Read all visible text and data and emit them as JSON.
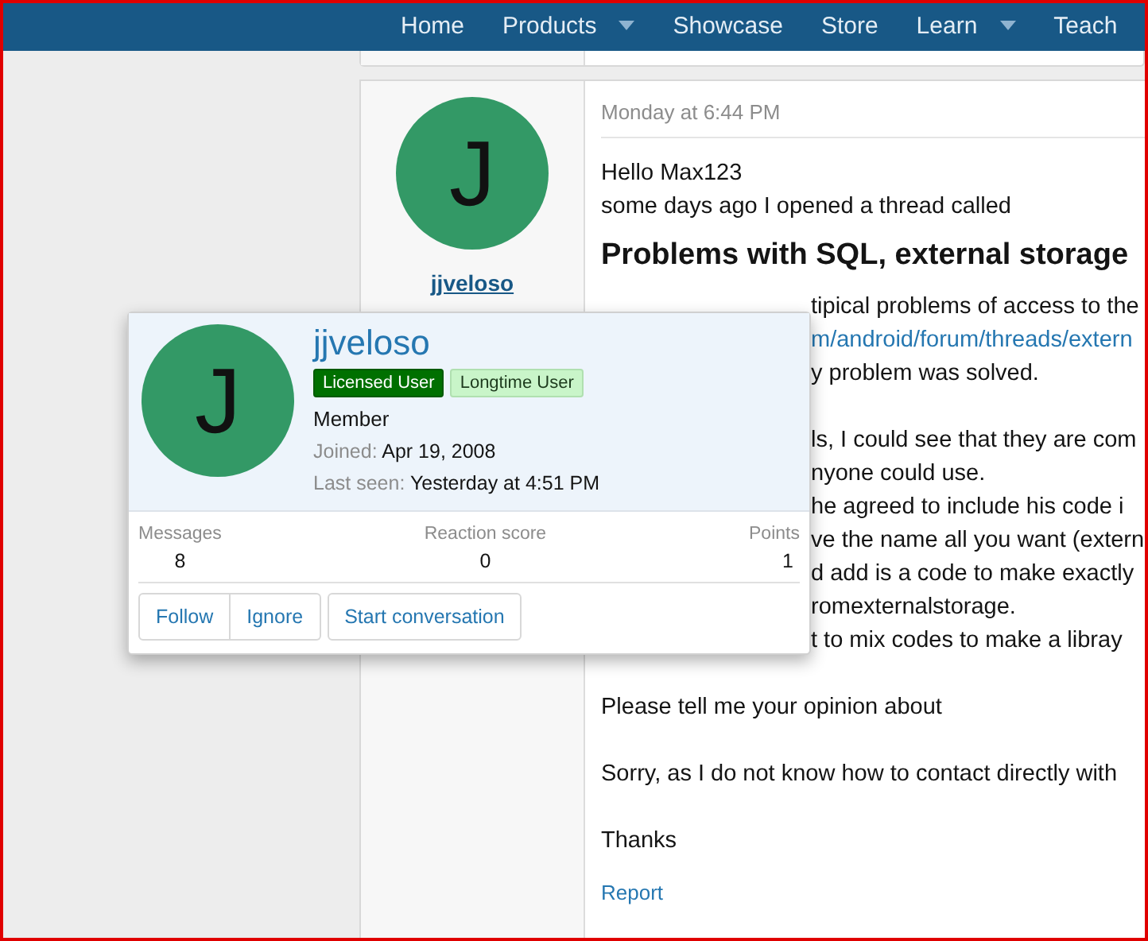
{
  "nav": [
    {
      "label": "Home",
      "dropdown": false
    },
    {
      "label": "Products",
      "dropdown": true
    },
    {
      "label": "Showcase",
      "dropdown": false
    },
    {
      "label": "Store",
      "dropdown": false
    },
    {
      "label": "Learn",
      "dropdown": true
    },
    {
      "label": "Teach",
      "dropdown": false
    }
  ],
  "post": {
    "author": {
      "initial": "J",
      "name": "jjveloso"
    },
    "time": "Monday at 6:44 PM",
    "lines": [
      {
        "kind": "text",
        "text": "Hello Max123"
      },
      {
        "kind": "text",
        "text": "some days ago I opened a thread called"
      },
      {
        "kind": "heading",
        "text": "Problems with SQL, external storage"
      },
      {
        "kind": "covered",
        "text": "tipical problems of access to the"
      },
      {
        "kind": "covered-link",
        "text": "m/android/forum/threads/extern"
      },
      {
        "kind": "covered",
        "text": "y problem was solved."
      },
      {
        "kind": "blank"
      },
      {
        "kind": "covered",
        "text": "ls, I could see that they are com"
      },
      {
        "kind": "covered",
        "text": "nyone could use."
      },
      {
        "kind": "covered",
        "text": "he agreed to include his code i"
      },
      {
        "kind": "covered",
        "text": "ve the name all you want (extern"
      },
      {
        "kind": "covered",
        "text": "d add is a code to make exactly"
      },
      {
        "kind": "covered",
        "text": "romexternalstorage."
      },
      {
        "kind": "covered",
        "text": "t to mix codes to make a libray"
      },
      {
        "kind": "blank"
      },
      {
        "kind": "text",
        "text": "Please tell me your opinion about"
      },
      {
        "kind": "blank"
      },
      {
        "kind": "text",
        "text": "Sorry, as I do not know how to contact directly with"
      },
      {
        "kind": "blank"
      },
      {
        "kind": "text",
        "text": "Thanks"
      }
    ],
    "report": "Report"
  },
  "popup": {
    "initial": "J",
    "name": "jjveloso",
    "badges": [
      {
        "label": "Licensed User",
        "kind": "strong"
      },
      {
        "label": "Longtime User",
        "kind": "light"
      }
    ],
    "title": "Member",
    "info": [
      {
        "label": "Joined:",
        "value": "Apr 19, 2008"
      },
      {
        "label": "Last seen:",
        "value": "Yesterday at 4:51 PM"
      }
    ],
    "stats": [
      {
        "label": "Messages",
        "value": "8"
      },
      {
        "label": "Reaction score",
        "value": "0"
      },
      {
        "label": "Points",
        "value": "1"
      }
    ],
    "buttons": [
      {
        "label": "Follow",
        "group": true
      },
      {
        "label": "Ignore",
        "group": true
      },
      {
        "label": "Start conversation",
        "group": false
      }
    ]
  }
}
